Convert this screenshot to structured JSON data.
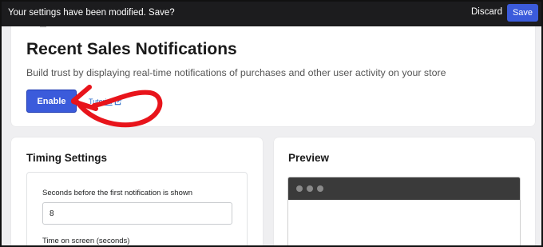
{
  "save_bar": {
    "message": "Your settings have been modified. Save?",
    "discard_label": "Discard",
    "save_label": "Save"
  },
  "header_card": {
    "title": "Recent Sales Notifications",
    "description": "Build trust by displaying real-time notifications of purchases and other user activity on your store",
    "enable_label": "Enable",
    "tutorial_label": "Tutorial"
  },
  "timing": {
    "title": "Timing Settings",
    "first_delay_label": "Seconds before the first notification is shown",
    "first_delay_value": "8",
    "time_on_screen_label": "Time on screen (seconds)"
  },
  "preview": {
    "title": "Preview"
  },
  "colors": {
    "accent": "#3b5bdb",
    "annotation_arrow": "#e8141b",
    "save_bar_bg": "#1c1c1e"
  },
  "icons": {
    "tutorial": "external-link-icon"
  }
}
